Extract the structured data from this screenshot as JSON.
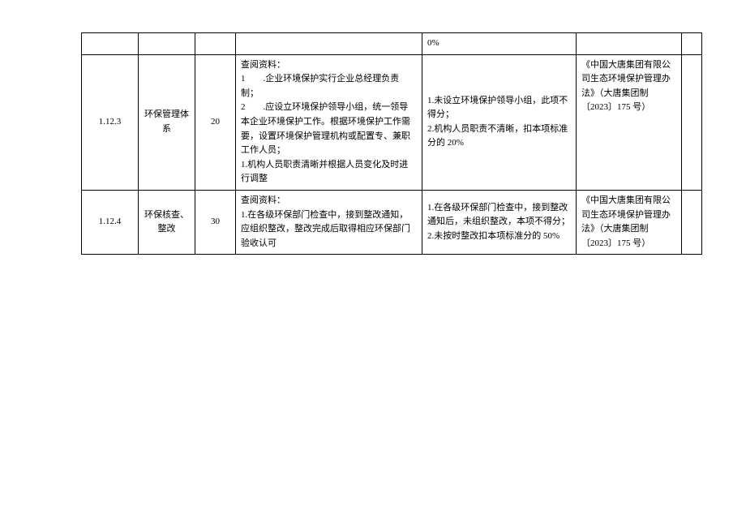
{
  "rows": [
    {
      "id": "",
      "name": "",
      "score": "",
      "desc": "",
      "criteria": "0%",
      "ref": "",
      "last": ""
    },
    {
      "id": "1.12.3",
      "name": "环保管理体系",
      "score": "20",
      "desc": "查阅资料：\n1　　.企业环境保护实行企业总经理负责制；\n2　　.应设立环境保护领导小组，统一领导本企业环境保护工作。根据环境保护工作需要，设置环境保护管理机构或配置专、兼职工作人员；\n1.机构人员职责清晰并根据人员变化及时进行调整",
      "criteria": "1.未设立环境保护领导小组，此项不得分；\n2.机构人员职责不清晰，扣本项标准分的 20%",
      "ref": "《中国大唐集团有限公司生态环境保护管理办法》（大唐集团制〔2023〕175 号）",
      "last": ""
    },
    {
      "id": "1.12.4",
      "name": "环保核查、整改",
      "score": "30",
      "desc": "查阅资料：\n1.在各级环保部门检查中，接到整改通知，应组织整改，整改完成后取得相应环保部门验收认可",
      "criteria": "1.在各级环保部门检查中，接到整改通知后，未组织整改，本项不得分；\n2.未按时整改扣本项标准分的 50%",
      "ref": "《中国大唐集团有限公司生态环境保护管理办法》（大唐集团制〔2023〕175 号）",
      "last": ""
    }
  ]
}
